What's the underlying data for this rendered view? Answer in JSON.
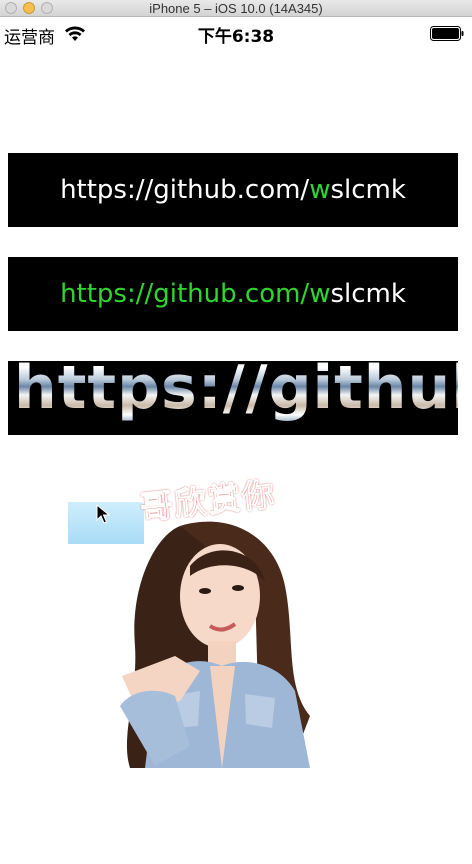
{
  "window": {
    "title": "iPhone 5 – iOS 10.0 (14A345)"
  },
  "status_bar": {
    "carrier": "运营商",
    "time": "下午6:38"
  },
  "banners": [
    {
      "segments": [
        {
          "text": "https://github.com/",
          "color": "white"
        },
        {
          "text": "w",
          "color": "green"
        },
        {
          "text": "slcmk",
          "color": "white"
        }
      ]
    },
    {
      "segments": [
        {
          "text": "https://github.com/w",
          "color": "green"
        },
        {
          "text": "slcmk",
          "color": "white"
        }
      ]
    },
    {
      "text": "https://github...."
    }
  ],
  "meme": {
    "caption": "哥欣赏你"
  },
  "colors": {
    "green": "#2fd62f",
    "banner_bg": "#000000"
  }
}
